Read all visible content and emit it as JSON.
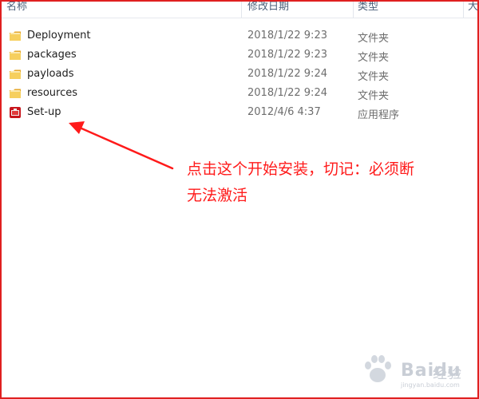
{
  "columns": {
    "name": "名称",
    "modified": "修改日期",
    "type": "类型",
    "size": "大"
  },
  "rows": [
    {
      "name": "Deployment",
      "date": "2018/1/22 9:23",
      "type": "文件夹",
      "icon": "folder-icon"
    },
    {
      "name": "packages",
      "date": "2018/1/22 9:23",
      "type": "文件夹",
      "icon": "folder-icon"
    },
    {
      "name": "payloads",
      "date": "2018/1/22 9:24",
      "type": "文件夹",
      "icon": "folder-icon"
    },
    {
      "name": "resources",
      "date": "2018/1/22 9:24",
      "type": "文件夹",
      "icon": "folder-icon"
    },
    {
      "name": "Set-up",
      "date": "2012/4/6 4:37",
      "type": "应用程序",
      "icon": "adobe-installer-icon"
    }
  ],
  "annotation": {
    "line1": "点击这个开始安装，切记：必须断",
    "line2": "无法激活",
    "color": "#ff1a1a"
  },
  "watermark": {
    "brand": "Bai",
    "brand2": "du",
    "label": "经验",
    "sub": "jingyan.baidu.com"
  },
  "colors": {
    "frame_border": "#e02020",
    "folder": "#f3c24f",
    "installer": "#c8161d"
  }
}
